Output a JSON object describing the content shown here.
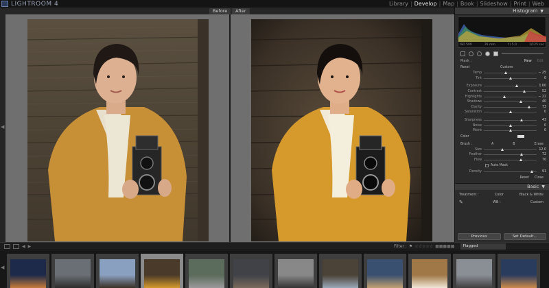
{
  "app": {
    "title": "LIGHTROOM 4"
  },
  "modules": [
    "Library",
    "Develop",
    "Map",
    "Book",
    "Slideshow",
    "Print",
    "Web"
  ],
  "active_module": "Develop",
  "view": {
    "before_label": "Before",
    "after_label": "After"
  },
  "panel": {
    "histogram_title": "Histogram",
    "histogram_info": {
      "iso": "ISO 500",
      "focal": "35 mm",
      "aperture": "f / 5.0",
      "shutter": "1/125 sec"
    },
    "mask_label": "Mask :",
    "mask_new": "New",
    "mask_edit": "Edit",
    "effect_reset": "Reset",
    "effect_preset": "Custom",
    "wb_sliders": [
      {
        "label": "Temp",
        "value": "− 25",
        "pos": 0.42
      },
      {
        "label": "Tint",
        "value": "0",
        "pos": 0.5
      }
    ],
    "tone_sliders": [
      {
        "label": "Exposure",
        "value": "1.00",
        "pos": 0.62
      },
      {
        "label": "Contrast",
        "value": "52",
        "pos": 0.76
      },
      {
        "label": "Highlights",
        "value": "− 22",
        "pos": 0.39
      },
      {
        "label": "Shadows",
        "value": "40",
        "pos": 0.7
      },
      {
        "label": "Clarity",
        "value": "73",
        "pos": 0.86
      },
      {
        "label": "Saturation",
        "value": "0",
        "pos": 0.5
      }
    ],
    "detail_sliders": [
      {
        "label": "Sharpness",
        "value": "43",
        "pos": 0.72
      },
      {
        "label": "Noise",
        "value": "0",
        "pos": 0.5
      },
      {
        "label": "Moiré",
        "value": "0",
        "pos": 0.5
      }
    ],
    "color_label": "Color",
    "brush": {
      "label": "Brush :",
      "a": "A",
      "b": "B",
      "erase": "Erase"
    },
    "brush_sliders": [
      {
        "label": "Size",
        "value": "12.0",
        "pos": 0.35
      },
      {
        "label": "Feather",
        "value": "72",
        "pos": 0.72
      },
      {
        "label": "Flow",
        "value": "70",
        "pos": 0.7
      }
    ],
    "auto_mask": "Auto Mask",
    "density": {
      "label": "Density",
      "value": "91",
      "pos": 0.91
    },
    "reset_label": "Reset",
    "close_label": "Close",
    "basic_title": "Basic",
    "treatment_label": "Treatment :",
    "treatment_color": "Color",
    "treatment_bw": "Black & White",
    "wb_label": "WB :",
    "wb_value": "Custom",
    "previous_button": "Previous",
    "set_default_button": "Set Default..."
  },
  "filterbar": {
    "filter_label": "Filter :",
    "flagged_value": "Flagged"
  },
  "colors": {
    "accent": "#e6e6e6",
    "panel_bg": "#2b2b2b",
    "coat": "#d69a2c",
    "wood": "#5a4a3a"
  },
  "filmstrip_count": 12,
  "filmstrip_selected_index": 3
}
